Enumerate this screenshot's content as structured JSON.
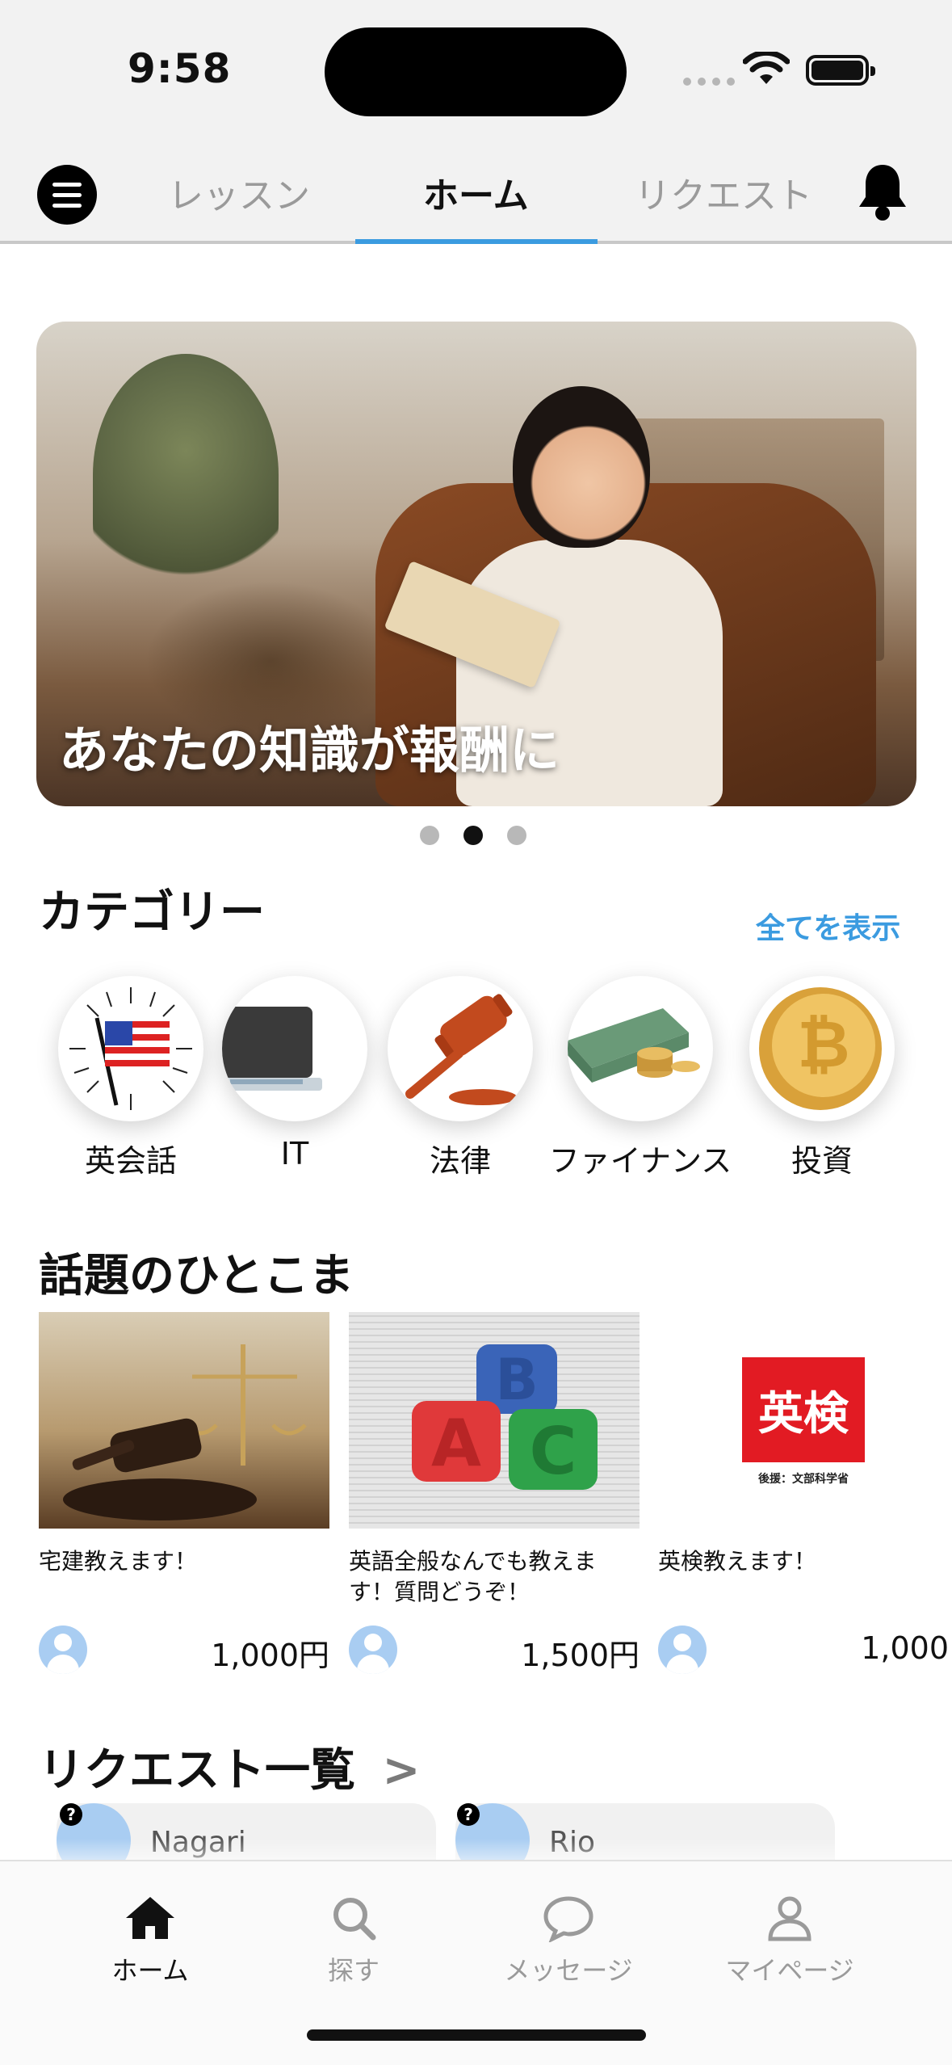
{
  "status_bar": {
    "time": "9:58"
  },
  "top_nav": {
    "tabs": [
      {
        "label": "レッスン"
      },
      {
        "label": "ホーム"
      },
      {
        "label": "リクエスト"
      }
    ],
    "active_tab": "ホーム",
    "accent_color": "#3b9be0"
  },
  "banner": {
    "caption": "あなたの知識が報酬に",
    "pages": 3,
    "active_page": 2
  },
  "categories": {
    "title": "カテゴリー",
    "see_all": "全てを表示",
    "items": [
      {
        "label": "英会話",
        "icon": "us-flag-icon"
      },
      {
        "label": "IT",
        "icon": "laptop-icon"
      },
      {
        "label": "法律",
        "icon": "gavel-icon"
      },
      {
        "label": "ファイナンス",
        "icon": "money-icon"
      },
      {
        "label": "投資",
        "icon": "bitcoin-icon"
      }
    ]
  },
  "hot_topics": {
    "title": "話題のひとこま",
    "cards": [
      {
        "title": "宅建教えます！",
        "price": "1,000円",
        "image": "gavel-scales"
      },
      {
        "title": "英語全般なんでも教えます！質問どうぞ！",
        "price": "1,500円",
        "image": "abc-blocks"
      },
      {
        "title": "英検教えます！",
        "price": "1,000",
        "image": "eiken-logo",
        "logo_text": "英検",
        "logo_sub": "後援：文部科学省"
      }
    ]
  },
  "requests": {
    "title": "リクエスト一覧",
    "chevron": ">",
    "items": [
      {
        "name": "Nagari"
      },
      {
        "name": "Rio"
      }
    ],
    "badge": "?"
  },
  "tab_bar": {
    "items": [
      {
        "label": "ホーム",
        "icon": "home-icon"
      },
      {
        "label": "探す",
        "icon": "search-icon"
      },
      {
        "label": "メッセージ",
        "icon": "message-icon"
      },
      {
        "label": "マイページ",
        "icon": "person-icon"
      }
    ],
    "active": "ホーム"
  }
}
